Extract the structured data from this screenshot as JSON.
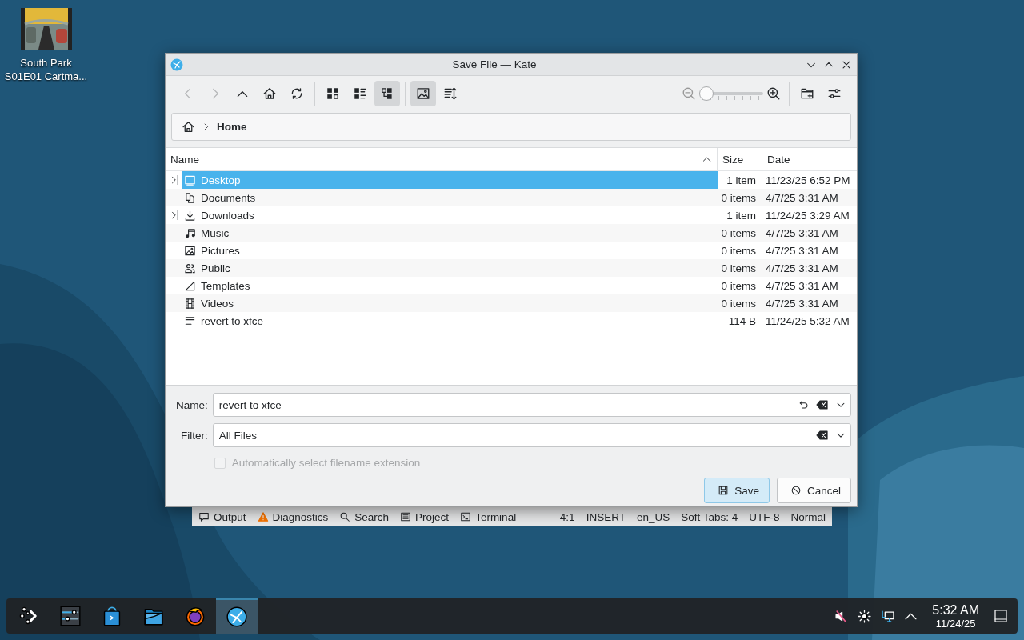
{
  "desktop_icons": [
    {
      "kind": "picture",
      "label_lines": [
        "South Park",
        "S01E01 Cartma..."
      ]
    }
  ],
  "kate_status": {
    "panels": [
      {
        "kind": "output",
        "label": "Output"
      },
      {
        "kind": "diagnostics",
        "label": "Diagnostics"
      },
      {
        "kind": "search",
        "label": "Search"
      },
      {
        "kind": "project",
        "label": "Project"
      },
      {
        "kind": "terminal",
        "label": "Terminal"
      }
    ],
    "info": [
      "4:1",
      "INSERT",
      "en_US",
      "Soft Tabs: 4",
      "UTF-8",
      "Normal"
    ]
  },
  "dialog": {
    "title": "Save File — Kate",
    "navigation": [
      {
        "kind": "back",
        "disabled": true
      },
      {
        "kind": "forward",
        "disabled": true
      },
      {
        "kind": "up",
        "disabled": false
      },
      {
        "kind": "home",
        "disabled": false
      },
      {
        "kind": "reload",
        "disabled": false
      }
    ],
    "view_modes": [
      {
        "kind": "icons",
        "selected": false
      },
      {
        "kind": "details",
        "selected": false
      },
      {
        "kind": "tree",
        "selected": true
      }
    ],
    "preview_toggle": {
      "on": true
    },
    "zoom": {
      "level": 0.0
    },
    "breadcrumb": [
      "Home"
    ],
    "columns": [
      {
        "label": "Name",
        "sorted": true
      },
      {
        "label": "Size",
        "sorted": false
      },
      {
        "label": "Date",
        "sorted": false
      }
    ],
    "rows": [
      {
        "kind": "desktop",
        "name": "Desktop",
        "size": "1 item",
        "date": "11/23/25 6:52 PM",
        "selected": true,
        "expandable": true
      },
      {
        "kind": "documents",
        "name": "Documents",
        "size": "0 items",
        "date": "4/7/25 3:31 AM",
        "selected": false,
        "expandable": false
      },
      {
        "kind": "downloads",
        "name": "Downloads",
        "size": "1 item",
        "date": "11/24/25 3:29 AM",
        "selected": false,
        "expandable": true
      },
      {
        "kind": "music",
        "name": "Music",
        "size": "0 items",
        "date": "4/7/25 3:31 AM",
        "selected": false,
        "expandable": false
      },
      {
        "kind": "pictures",
        "name": "Pictures",
        "size": "0 items",
        "date": "4/7/25 3:31 AM",
        "selected": false,
        "expandable": false
      },
      {
        "kind": "public",
        "name": "Public",
        "size": "0 items",
        "date": "4/7/25 3:31 AM",
        "selected": false,
        "expandable": false
      },
      {
        "kind": "templates",
        "name": "Templates",
        "size": "0 items",
        "date": "4/7/25 3:31 AM",
        "selected": false,
        "expandable": false
      },
      {
        "kind": "videos",
        "name": "Videos",
        "size": "0 items",
        "date": "4/7/25 3:31 AM",
        "selected": false,
        "expandable": false
      },
      {
        "kind": "text",
        "name": "revert to xfce",
        "size": "114 B",
        "date": "11/24/25 5:32 AM",
        "selected": false,
        "expandable": false
      }
    ],
    "name_field": {
      "label": "Name:",
      "value": "revert to xfce"
    },
    "filter_field": {
      "label": "Filter:",
      "value": "All Files"
    },
    "extension_checkbox": {
      "label": "Automatically select filename extension",
      "checked": false,
      "disabled": true
    },
    "buttons": [
      {
        "kind": "save",
        "label": "Save",
        "default": true
      },
      {
        "kind": "cancel",
        "label": "Cancel",
        "default": false
      }
    ]
  },
  "taskbar": {
    "apps": [
      {
        "kind": "launcher",
        "selected": false
      },
      {
        "kind": "settings",
        "selected": false
      },
      {
        "kind": "store",
        "selected": false
      },
      {
        "kind": "files",
        "selected": false
      },
      {
        "kind": "browser",
        "selected": false
      },
      {
        "kind": "kate",
        "selected": true
      }
    ],
    "tray": [
      {
        "kind": "muted"
      },
      {
        "kind": "brightness"
      },
      {
        "kind": "network"
      },
      {
        "kind": "expand"
      }
    ],
    "time": "5:32 AM",
    "date": "11/24/25"
  }
}
